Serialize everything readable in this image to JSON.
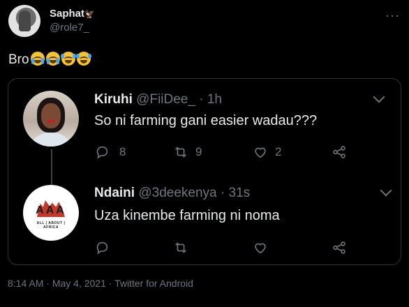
{
  "tweet": {
    "display_name": "Saphat",
    "verified_glyph": "🦅",
    "username": "@role7_",
    "more_icon": "more-horizontal-icon",
    "text": "Bro",
    "emojis": [
      "loudly-crying-face",
      "loudly-crying-face",
      "face-with-tears-of-joy",
      "face-with-tears-of-joy"
    ]
  },
  "quote": {
    "first": {
      "name": "Kiruhi",
      "handle": "@FiiDee_",
      "separator": "·",
      "time": "1h",
      "text": "So ni farming gani easier wadau???",
      "reply_count": "8",
      "retweet_count": "9",
      "like_count": "2"
    },
    "second": {
      "name": "Ndaini",
      "handle": "@3deekenya",
      "separator": "·",
      "time": "31s",
      "text": "Uza kinembe farming ni noma",
      "logo_letters": "AAA",
      "logo_tagline": "ALL | ABOUT | AFRICA"
    }
  },
  "footer": {
    "time": "8:14 AM",
    "separator1": "·",
    "date": "May 4, 2021",
    "separator2": "·",
    "source": "Twitter for Android"
  },
  "colors": {
    "background": "#000000",
    "text_primary": "#e7e9ea",
    "text_secondary": "#6e767d",
    "border": "#2f3336"
  }
}
